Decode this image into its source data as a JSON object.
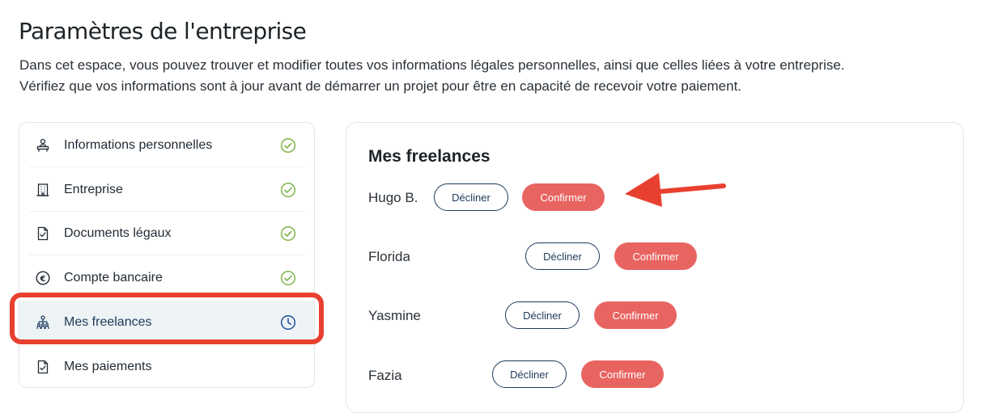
{
  "page": {
    "title": "Paramètres de l'entreprise",
    "description_line1": "Dans cet espace, vous pouvez trouver et modifier toutes vos informations légales personnelles, ainsi que celles liées à votre entreprise.",
    "description_line2": "Vérifiez que vos informations sont à jour avant de démarrer un projet pour être en capacité de recevoir votre paiement."
  },
  "sidebar": {
    "items": [
      {
        "label": "Informations personnelles",
        "icon": "person-desk-icon",
        "status": "check-circle-icon"
      },
      {
        "label": "Entreprise",
        "icon": "building-icon",
        "status": "check-circle-icon"
      },
      {
        "label": "Documents légaux",
        "icon": "document-check-icon",
        "status": "check-circle-icon"
      },
      {
        "label": "Compte bancaire",
        "icon": "euro-circle-icon",
        "status": "check-circle-icon"
      },
      {
        "label": "Mes freelances",
        "icon": "team-icon",
        "status": "clock-icon",
        "active": true
      },
      {
        "label": "Mes paiements",
        "icon": "document-check-icon",
        "status": ""
      }
    ]
  },
  "panel": {
    "title": "Mes freelances",
    "decline_label": "Décliner",
    "confirm_label": "Confirmer",
    "freelances": [
      {
        "name": "Hugo B."
      },
      {
        "name": "Florida"
      },
      {
        "name": "Yasmine"
      },
      {
        "name": "Fazia"
      }
    ]
  },
  "colors": {
    "accent_navy": "#1e3a5a",
    "confirm_red": "#e86461",
    "annotation_red": "#e8402f",
    "check_green": "#7cb342",
    "active_bg": "#eef3f5"
  }
}
